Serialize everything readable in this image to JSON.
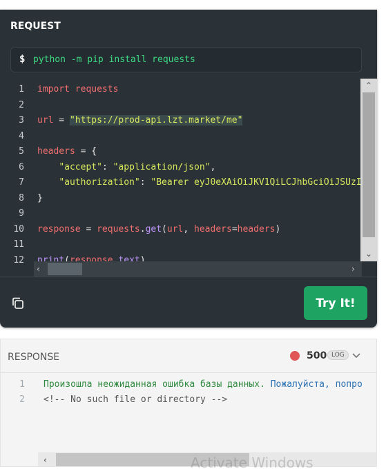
{
  "request": {
    "title": "REQUEST",
    "prompt": "$",
    "command": "python -m pip install requests",
    "try_button": "Try It!"
  },
  "code_lines": [
    {
      "num": "1",
      "tokens": [
        {
          "t": "import",
          "c": "kw"
        },
        {
          "t": " requests",
          "c": "var"
        }
      ]
    },
    {
      "num": "2",
      "tokens": []
    },
    {
      "num": "3",
      "tokens": [
        {
          "t": "url",
          "c": "var"
        },
        {
          "t": " = ",
          "c": "pl"
        },
        {
          "t": "\"https://prod-api.lzt.market/me\"",
          "c": "str",
          "hl": true
        }
      ]
    },
    {
      "num": "4",
      "tokens": []
    },
    {
      "num": "5",
      "tokens": [
        {
          "t": "headers",
          "c": "var"
        },
        {
          "t": " = {",
          "c": "pl"
        }
      ]
    },
    {
      "num": "6",
      "tokens": [
        {
          "t": "    ",
          "c": "pl"
        },
        {
          "t": "\"accept\"",
          "c": "str"
        },
        {
          "t": ": ",
          "c": "pl"
        },
        {
          "t": "\"application/json\"",
          "c": "str"
        },
        {
          "t": ",",
          "c": "pl"
        }
      ]
    },
    {
      "num": "7",
      "tokens": [
        {
          "t": "    ",
          "c": "pl"
        },
        {
          "t": "\"authorization\"",
          "c": "str"
        },
        {
          "t": ": ",
          "c": "pl"
        },
        {
          "t": "\"Bearer eyJ0eXAiOiJKV1QiLCJhbGciOiJSUzI",
          "c": "str"
        }
      ]
    },
    {
      "num": "8",
      "tokens": [
        {
          "t": "}",
          "c": "pl"
        }
      ]
    },
    {
      "num": "9",
      "tokens": []
    },
    {
      "num": "10",
      "tokens": [
        {
          "t": "response",
          "c": "var"
        },
        {
          "t": " = ",
          "c": "pl"
        },
        {
          "t": "requests",
          "c": "var"
        },
        {
          "t": ".",
          "c": "pl"
        },
        {
          "t": "get",
          "c": "fn"
        },
        {
          "t": "(",
          "c": "pl"
        },
        {
          "t": "url",
          "c": "var"
        },
        {
          "t": ", ",
          "c": "pl"
        },
        {
          "t": "headers",
          "c": "var"
        },
        {
          "t": "=",
          "c": "pl"
        },
        {
          "t": "headers",
          "c": "var"
        },
        {
          "t": ")",
          "c": "pl"
        }
      ]
    },
    {
      "num": "11",
      "tokens": []
    },
    {
      "num": "12",
      "tokens": [
        {
          "t": "print",
          "c": "fn"
        },
        {
          "t": "(",
          "c": "pl"
        },
        {
          "t": "response",
          "c": "var"
        },
        {
          "t": ".",
          "c": "pl"
        },
        {
          "t": "text",
          "c": "fn"
        },
        {
          "t": ")",
          "c": "pl"
        }
      ]
    }
  ],
  "response": {
    "title": "RESPONSE",
    "status_code": "500",
    "status_color": "#e05656",
    "log_badge": "LOG",
    "lines": [
      {
        "num": "1",
        "tokens": [
          {
            "t": "Произошла неожиданная ошибка базы данных.",
            "c": "t-green"
          },
          {
            "t": " Пожалуйста, попро",
            "c": "t-blue"
          }
        ]
      },
      {
        "num": "2",
        "tokens": [
          {
            "t": "<!-- No such file or directory -->",
            "c": "t-gray"
          }
        ]
      }
    ]
  },
  "watermark": "Activate Windows",
  "colors": {
    "accent_green": "#1fa363",
    "dark_bg": "#2b3237"
  }
}
